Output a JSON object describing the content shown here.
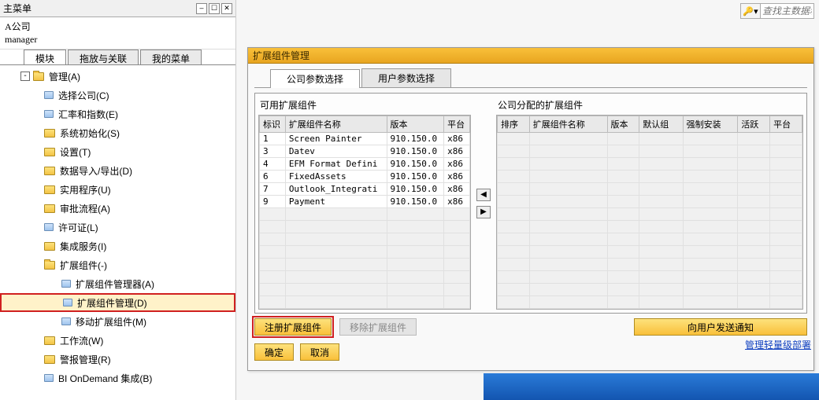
{
  "panel": {
    "title": "主菜单",
    "company": "A公司",
    "user": "manager",
    "tabs": [
      "模块",
      "拖放与关联",
      "我的菜单"
    ],
    "active_tab": 0
  },
  "tree": [
    {
      "lvl": 1,
      "type": "folder",
      "open": true,
      "label": "管理(A)"
    },
    {
      "lvl": 2,
      "type": "item",
      "label": "选择公司(C)"
    },
    {
      "lvl": 2,
      "type": "item",
      "label": "汇率和指数(E)"
    },
    {
      "lvl": 2,
      "type": "folder",
      "label": "系统初始化(S)"
    },
    {
      "lvl": 2,
      "type": "folder",
      "label": "设置(T)"
    },
    {
      "lvl": 2,
      "type": "folder",
      "label": "数据导入/导出(D)"
    },
    {
      "lvl": 2,
      "type": "folder",
      "label": "实用程序(U)"
    },
    {
      "lvl": 2,
      "type": "folder",
      "label": "审批流程(A)"
    },
    {
      "lvl": 2,
      "type": "item",
      "label": "许可证(L)"
    },
    {
      "lvl": 2,
      "type": "folder",
      "label": "集成服务(I)"
    },
    {
      "lvl": 2,
      "type": "folder",
      "open": true,
      "label": "扩展组件(-)"
    },
    {
      "lvl": 3,
      "type": "item",
      "label": "扩展组件管理器(A)"
    },
    {
      "lvl": 3,
      "type": "item",
      "label": "扩展组件管理(D)",
      "selected": true,
      "highlight": true
    },
    {
      "lvl": 3,
      "type": "item",
      "label": "移动扩展组件(M)"
    },
    {
      "lvl": 2,
      "type": "folder",
      "label": "工作流(W)"
    },
    {
      "lvl": 2,
      "type": "folder",
      "label": "警报管理(R)"
    },
    {
      "lvl": 2,
      "type": "item",
      "label": "BI OnDemand 集成(B)"
    }
  ],
  "search": {
    "placeholder": "查找主数据和"
  },
  "content": {
    "title": "扩展组件管理",
    "tabs": [
      "公司参数选择",
      "用户参数选择"
    ],
    "active_tab": 0,
    "avail_title": "可用扩展组件",
    "assigned_title": "公司分配的扩展组件",
    "avail_cols": [
      "标识",
      "扩展组件名称",
      "版本",
      "平台"
    ],
    "assigned_cols": [
      "排序",
      "扩展组件名称",
      "版本",
      "默认组",
      "强制安装",
      "活跃",
      "平台"
    ],
    "avail_rows": [
      {
        "id": "1",
        "name": "Screen Painter",
        "ver": "910.150.0",
        "plat": "x86"
      },
      {
        "id": "3",
        "name": "Datev",
        "ver": "910.150.0",
        "plat": "x86"
      },
      {
        "id": "4",
        "name": "EFM Format Defini",
        "ver": "910.150.0",
        "plat": "x86"
      },
      {
        "id": "6",
        "name": "FixedAssets",
        "ver": "910.150.0",
        "plat": "x86"
      },
      {
        "id": "7",
        "name": "Outlook_Integrati",
        "ver": "910.150.0",
        "plat": "x86"
      },
      {
        "id": "9",
        "name": "Payment",
        "ver": "910.150.0",
        "plat": "x86"
      }
    ],
    "btn_register": "注册扩展组件",
    "btn_remove": "移除扩展组件",
    "btn_send": "向用户发送通知",
    "btn_ok": "确定",
    "btn_cancel": "取消",
    "link": "管理轻量级部署"
  }
}
